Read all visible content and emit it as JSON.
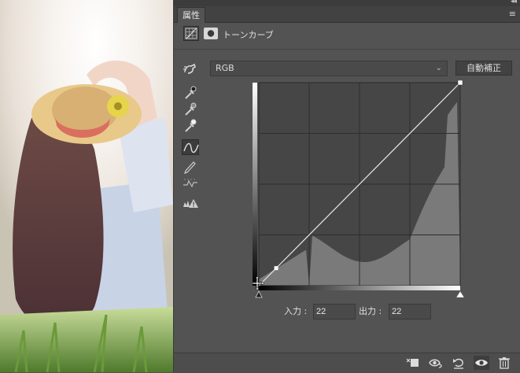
{
  "panel": {
    "tab_label": "属性",
    "adjustment_title": "トーンカーブ"
  },
  "curves": {
    "channel": "RGB",
    "auto_label": "自動補正",
    "input_label": "入力 :",
    "input_value": "22",
    "output_label": "出力 :",
    "output_value": "22",
    "control_point": {
      "input": 22,
      "output": 22
    }
  },
  "tools": [
    "on-image-adjust-icon",
    "black-point-eyedropper-icon",
    "gray-point-eyedropper-icon",
    "white-point-eyedropper-icon",
    "curve-point-icon",
    "pencil-draw-icon",
    "smooth-curve-icon",
    "clipping-warning-icon"
  ],
  "bottom_icons": [
    "clip-to-layer-icon",
    "view-previous-state-icon",
    "reset-icon",
    "visibility-eye-icon",
    "delete-trash-icon"
  ],
  "colors": {
    "panel_bg": "#535353",
    "graph_bg": "#464646",
    "histogram": "#7a7a7a"
  }
}
